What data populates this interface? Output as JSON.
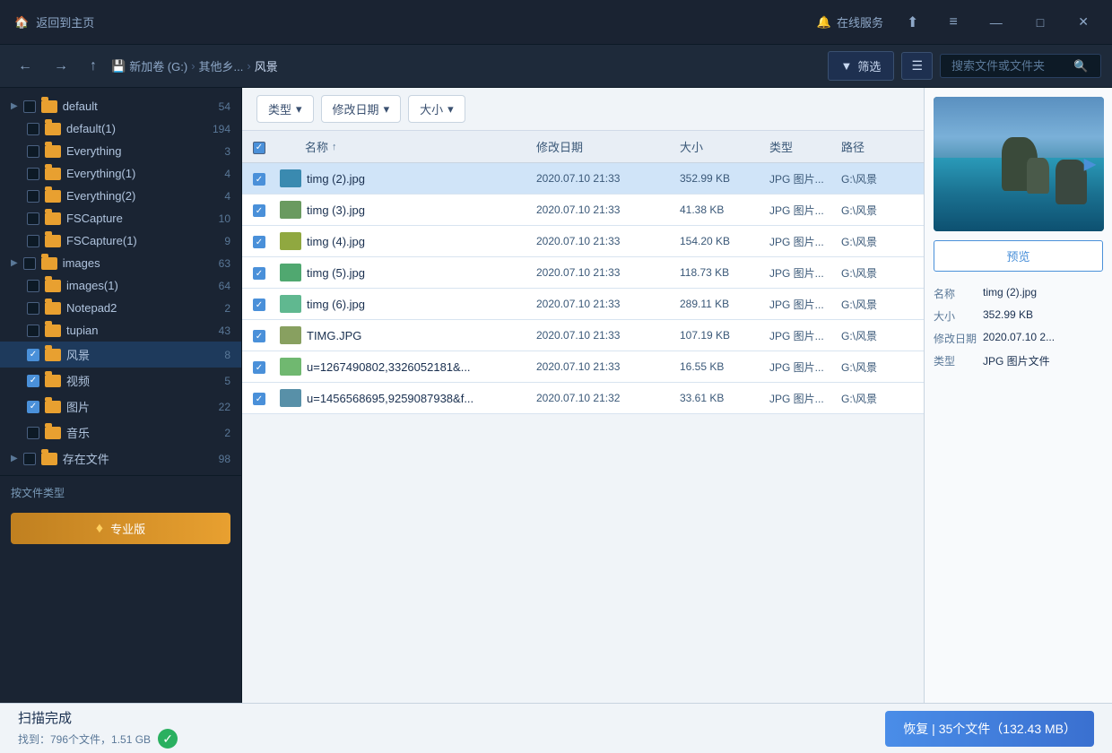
{
  "titlebar": {
    "home_label": "返回到主页",
    "online_label": "在线服务",
    "share_icon": "⬆",
    "menu_icon": "≡",
    "min_icon": "—",
    "max_icon": "□",
    "close_icon": "✕"
  },
  "toolbar": {
    "nav_back": "←",
    "nav_forward": "→",
    "nav_up": "↑",
    "drive_label": "新加卷 (G:)",
    "breadcrumb_sep1": "›",
    "folder1": "其他乡...",
    "breadcrumb_sep2": "›",
    "folder2": "风景",
    "filter_label": "筛选",
    "view_icon": "☰",
    "search_placeholder": "搜索文件或文件夹"
  },
  "filter_bar": {
    "type_label": "类型",
    "date_label": "修改日期",
    "size_label": "大小",
    "dropdown_arrow": "▾"
  },
  "table_header": {
    "check": "✓",
    "name": "名称",
    "sort_arrow": "↑",
    "date": "修改日期",
    "size": "大小",
    "type": "类型",
    "path": "路径"
  },
  "files": [
    {
      "id": 1,
      "name": "timg (2).jpg",
      "date": "2020.07.10 21:33",
      "size": "352.99 KB",
      "type": "JPG 图片...",
      "path": "G:\\风景",
      "checked": true,
      "selected": true,
      "color": "#3a8ab0"
    },
    {
      "id": 2,
      "name": "timg (3).jpg",
      "date": "2020.07.10 21:33",
      "size": "41.38 KB",
      "type": "JPG 图片...",
      "path": "G:\\风景",
      "checked": true,
      "selected": false,
      "color": "#6a9a60"
    },
    {
      "id": 3,
      "name": "timg (4).jpg",
      "date": "2020.07.10 21:33",
      "size": "154.20 KB",
      "type": "JPG 图片...",
      "path": "G:\\风景",
      "checked": true,
      "selected": false,
      "color": "#90a840"
    },
    {
      "id": 4,
      "name": "timg (5).jpg",
      "date": "2020.07.10 21:33",
      "size": "118.73 KB",
      "type": "JPG 图片...",
      "path": "G:\\风景",
      "checked": true,
      "selected": false,
      "color": "#50a870"
    },
    {
      "id": 5,
      "name": "timg (6).jpg",
      "date": "2020.07.10 21:33",
      "size": "289.11 KB",
      "type": "JPG 图片...",
      "path": "G:\\风景",
      "checked": true,
      "selected": false,
      "color": "#60b890"
    },
    {
      "id": 6,
      "name": "TIMG.JPG",
      "date": "2020.07.10 21:33",
      "size": "107.19 KB",
      "type": "JPG 图片...",
      "path": "G:\\风景",
      "checked": true,
      "selected": false,
      "color": "#88a060"
    },
    {
      "id": 7,
      "name": "u=1267490802,3326052181&...",
      "date": "2020.07.10 21:33",
      "size": "16.55 KB",
      "type": "JPG 图片...",
      "path": "G:\\风景",
      "checked": true,
      "selected": false,
      "color": "#70b870"
    },
    {
      "id": 8,
      "name": "u=1456568695,9259087938&f...",
      "date": "2020.07.10 21:32",
      "size": "33.61 KB",
      "type": "JPG 图片...",
      "path": "G:\\风景",
      "checked": true,
      "selected": false,
      "color": "#5890a8"
    }
  ],
  "sidebar": {
    "items": [
      {
        "id": "default",
        "label": "default",
        "count": "54",
        "checked": false,
        "expanded": true
      },
      {
        "id": "default1",
        "label": "default(1)",
        "count": "194",
        "checked": false,
        "expanded": false
      },
      {
        "id": "everything",
        "label": "Everything",
        "count": "3",
        "checked": false,
        "expanded": false
      },
      {
        "id": "everything1",
        "label": "Everything(1)",
        "count": "4",
        "checked": false,
        "expanded": false
      },
      {
        "id": "everything2",
        "label": "Everything(2)",
        "count": "4",
        "checked": false,
        "expanded": false
      },
      {
        "id": "fscapture",
        "label": "FSCapture",
        "count": "10",
        "checked": false,
        "expanded": false
      },
      {
        "id": "fscapture1",
        "label": "FSCapture(1)",
        "count": "9",
        "checked": false,
        "expanded": false
      },
      {
        "id": "images",
        "label": "images",
        "count": "63",
        "checked": false,
        "expanded": true
      },
      {
        "id": "images1",
        "label": "images(1)",
        "count": "64",
        "checked": false,
        "expanded": false
      },
      {
        "id": "notepad2",
        "label": "Notepad2",
        "count": "2",
        "checked": false,
        "expanded": false
      },
      {
        "id": "tupian",
        "label": "tupian",
        "count": "43",
        "checked": false,
        "expanded": false
      },
      {
        "id": "fengjing",
        "label": "风景",
        "count": "8",
        "checked": true,
        "expanded": false
      },
      {
        "id": "shipin",
        "label": "视频",
        "count": "5",
        "checked": true,
        "expanded": false
      },
      {
        "id": "tupian2",
        "label": "图片",
        "count": "22",
        "checked": true,
        "expanded": false
      },
      {
        "id": "yinyue",
        "label": "音乐",
        "count": "2",
        "checked": false,
        "expanded": false
      },
      {
        "id": "cunchuwenjian",
        "label": "存在文件",
        "count": "98",
        "checked": false,
        "expanded": true
      }
    ],
    "bottom_label": "按文件类型",
    "pro_btn_label": "专业版",
    "diamond_icon": "♦"
  },
  "right_panel": {
    "preview_btn_label": "预览",
    "file_info": {
      "name_label": "名称",
      "name_value": "timg (2).jpg",
      "size_label": "大小",
      "size_value": "352.99 KB",
      "date_label": "修改日期",
      "date_value": "2020.07.10 2...",
      "type_label": "类型",
      "type_value": "JPG 图片文件"
    }
  },
  "bottom_bar": {
    "scan_title": "扫描完成",
    "scan_detail": "找到：796个文件，1.51 GB",
    "ok_icon": "✓",
    "recover_btn": "恢复 | 35个文件（132.43 MB）"
  }
}
